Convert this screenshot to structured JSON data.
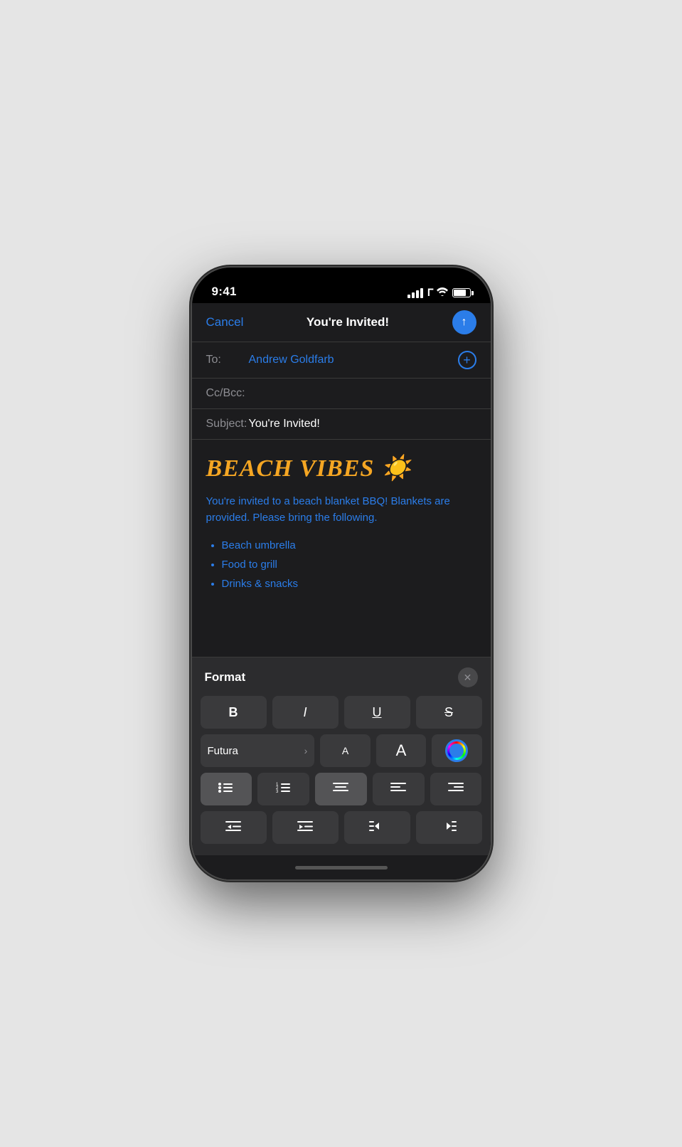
{
  "statusBar": {
    "time": "9:41",
    "batteryLevel": "80"
  },
  "emailHeader": {
    "cancelLabel": "Cancel",
    "titleLabel": "You're Invited!",
    "sendArrow": "↑"
  },
  "toField": {
    "label": "To:",
    "recipient": "Andrew Goldfarb"
  },
  "ccField": {
    "label": "Cc/Bcc:"
  },
  "subjectField": {
    "label": "Subject:",
    "value": "You're Invited!"
  },
  "emailBody": {
    "headline": "BEACH VIBES ☀️",
    "paragraph": "You're invited to a beach blanket BBQ! Blankets are provided. Please bring the following.",
    "listItems": [
      "Beach umbrella",
      "Food to grill",
      "Drinks & snacks"
    ]
  },
  "formatPanel": {
    "title": "Format",
    "closeIcon": "✕",
    "buttons": {
      "bold": "B",
      "italic": "I",
      "underline": "U",
      "strikethrough": "S",
      "fontName": "Futura",
      "fontChevron": "›",
      "sizeSmall": "A",
      "sizeLarge": "A"
    },
    "toolbar": {
      "bulletList": "≡",
      "numberedList": "≡",
      "alignCenter": "≡",
      "alignLeft": "≡",
      "alignRight": "≡",
      "decreaseIndent": "⊢",
      "increaseIndent": "⊣",
      "decreaseQuote": "≡",
      "increaseQuote": "≡"
    }
  }
}
